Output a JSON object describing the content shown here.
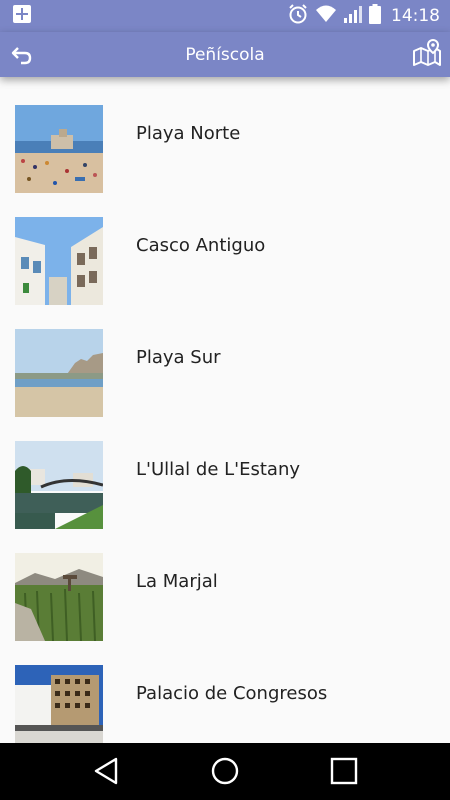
{
  "status_bar": {
    "time": "14:18",
    "icons": [
      "notification-plus-icon",
      "alarm-icon",
      "wifi-icon",
      "signal-icon",
      "battery-icon"
    ]
  },
  "app_bar": {
    "title": "Peñíscola",
    "back_icon": "back-arrow-icon",
    "map_icon": "map-pin-icon",
    "color": "#7b86c6"
  },
  "places": [
    {
      "label": "Playa Norte",
      "thumb": "beach-castle-photo"
    },
    {
      "label": "Casco Antiguo",
      "thumb": "old-town-photo"
    },
    {
      "label": "Playa Sur",
      "thumb": "south-beach-photo"
    },
    {
      "label": "L'Ullal de L'Estany",
      "thumb": "river-bridge-photo"
    },
    {
      "label": "La Marjal",
      "thumb": "wetland-photo"
    },
    {
      "label": "Palacio de Congresos",
      "thumb": "congress-building-photo"
    }
  ],
  "nav_bar": {
    "icons": [
      "back-triangle-icon",
      "home-circle-icon",
      "recents-square-icon"
    ]
  }
}
